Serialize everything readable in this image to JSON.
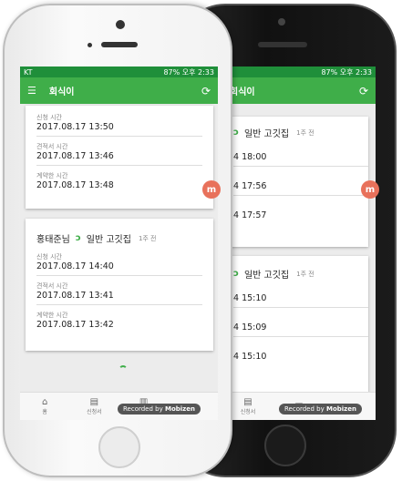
{
  "status": {
    "carrier": "KT",
    "right": "87% 오후 2:33"
  },
  "appbar": {
    "title": "회식이"
  },
  "white": {
    "card1": {
      "fields": [
        {
          "label": "신청 시간",
          "value": "2017.08.17 13:50"
        },
        {
          "label": "견적서 시간",
          "value": "2017.08.17 13:46"
        },
        {
          "label": "계약한 시간",
          "value": "2017.08.17 13:48"
        }
      ]
    },
    "card2": {
      "name": "홍태준님",
      "category": "일반 고깃집",
      "ago": "1주 전",
      "fields": [
        {
          "label": "신청 시간",
          "value": "2017.08.17 14:40"
        },
        {
          "label": "견적서 시간",
          "value": "2017.08.17 13:41"
        },
        {
          "label": "계약한 시간",
          "value": "2017.08.17 13:42"
        }
      ]
    }
  },
  "black": {
    "card1": {
      "category": "일반 고깃집",
      "ago": "1주 전",
      "values": [
        "4 18:00",
        "4 17:56",
        "4 17:57"
      ]
    },
    "card2": {
      "category": "일반 고깃집",
      "ago": "1주 전",
      "values": [
        "4 15:10",
        "4 15:09",
        "4 15:10"
      ]
    }
  },
  "nav": {
    "home": "홈",
    "applications": "신청서",
    "review": "진",
    "contracts": "신청서"
  },
  "recorded": "Recorded by",
  "recorded_brand": "Mobizen",
  "badge_letter": "m",
  "icons": {
    "menu": "☰",
    "refresh": "⟳",
    "leaf": "ↄ"
  }
}
